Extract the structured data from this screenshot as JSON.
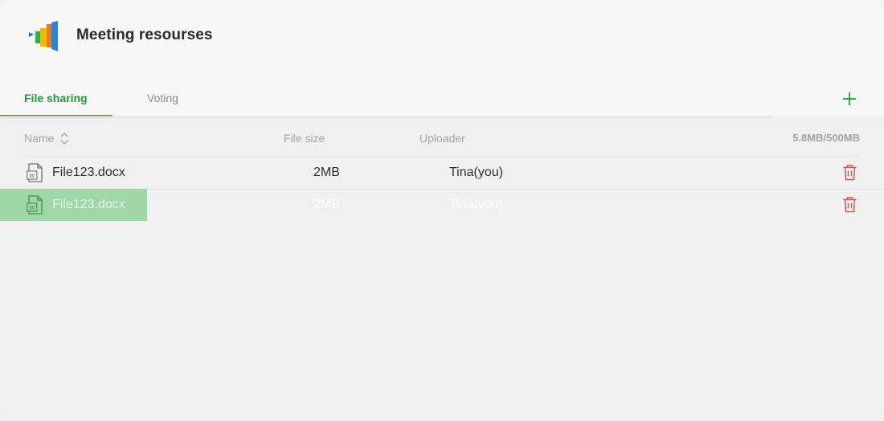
{
  "header": {
    "title": "Meeting resourses",
    "logo_icon": "app-logo-icon"
  },
  "tabs": [
    {
      "label": "File sharing",
      "active": true
    },
    {
      "label": "Voting",
      "active": false
    }
  ],
  "table": {
    "columns": {
      "name": "Name",
      "size": "File size",
      "uploader": "Uploader"
    },
    "storage_usage": "5.8MB/500MB",
    "rows": [
      {
        "name": "File123.docx",
        "size": "2MB",
        "uploader": "Tina(you)",
        "state": "normal"
      },
      {
        "name": "File123.docx",
        "size": "2MB",
        "uploader": "Tina(you)",
        "state": "dragging"
      }
    ]
  },
  "colors": {
    "accent": "#1f9a3a",
    "delete": "#d9534f",
    "drag_highlight": "#9fd7a8"
  },
  "icons": {
    "add": "plus-icon",
    "sort": "sort-icon",
    "file": "word-document-icon",
    "delete": "trash-icon"
  }
}
